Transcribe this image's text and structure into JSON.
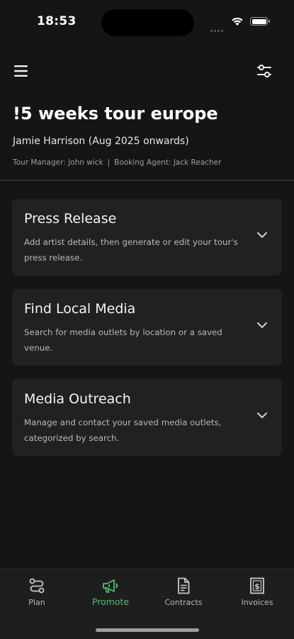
{
  "status_bar": {
    "time": "18:53"
  },
  "header": {
    "title": "!5 weeks tour europe",
    "subtitle": "Jamie Harrison (Aug 2025 onwards)",
    "tour_manager": "Tour Manager: John wick",
    "separator": "|",
    "booking_agent": "Booking Agent: Jack Reacher"
  },
  "cards": [
    {
      "title": "Press Release",
      "description": "Add artist details, then generate or edit your tour's press release."
    },
    {
      "title": "Find Local Media",
      "description": "Search for media outlets by location or a saved venue."
    },
    {
      "title": "Media Outreach",
      "description": "Manage and contact your saved media outlets, categorized by search."
    }
  ],
  "bottom_nav": {
    "items": [
      {
        "label": "Plan",
        "icon": "route-icon",
        "active": false
      },
      {
        "label": "Promote",
        "icon": "megaphone-icon",
        "active": true
      },
      {
        "label": "Contracts",
        "icon": "document-icon",
        "active": false
      },
      {
        "label": "Invoices",
        "icon": "invoice-dollar-icon",
        "active": false
      }
    ]
  },
  "colors": {
    "background": "#151517",
    "card": "#212124",
    "accent_active": "#4fbf6f",
    "nav_background": "#1e1e20"
  }
}
